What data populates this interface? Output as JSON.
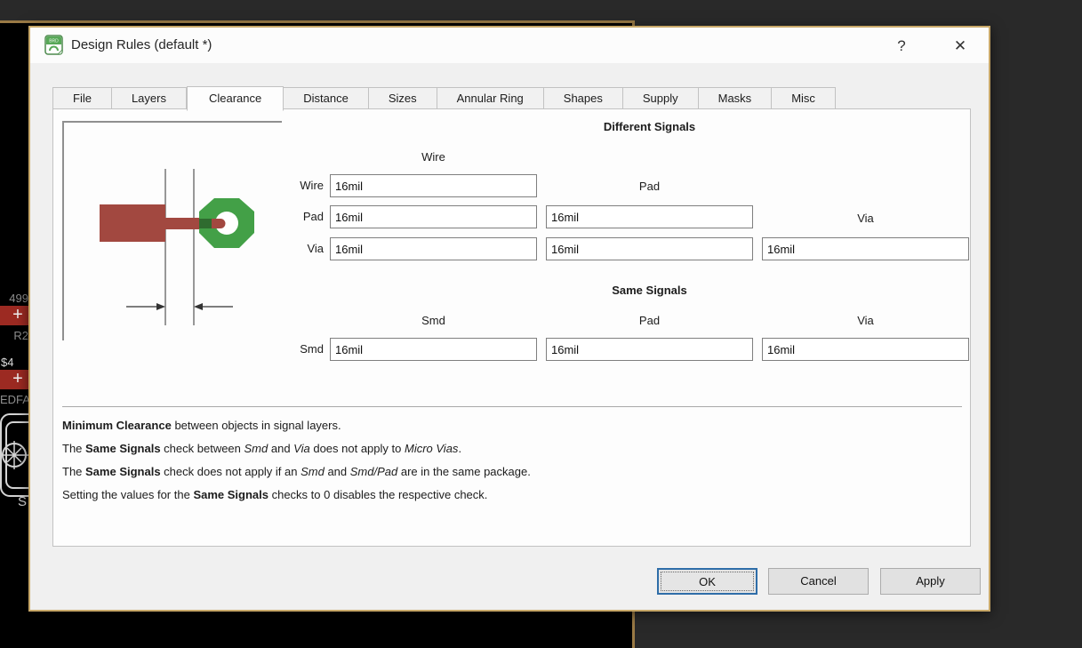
{
  "window": {
    "title": "Design Rules (default *)",
    "help_label": "?",
    "close_label": "✕"
  },
  "tabs": {
    "active_index": 2,
    "items": [
      "File",
      "Layers",
      "Clearance",
      "Distance",
      "Sizes",
      "Annular Ring",
      "Shapes",
      "Supply",
      "Masks",
      "Misc"
    ]
  },
  "clearance": {
    "different_signals": {
      "title": "Different Signals",
      "headers": {
        "wire": "Wire",
        "pad": "Pad",
        "via": "Via"
      },
      "rows": [
        {
          "label": "Wire",
          "values": [
            "16mil"
          ]
        },
        {
          "label": "Pad",
          "values": [
            "16mil",
            "16mil"
          ]
        },
        {
          "label": "Via",
          "values": [
            "16mil",
            "16mil",
            "16mil"
          ]
        }
      ]
    },
    "same_signals": {
      "title": "Same Signals",
      "headers": {
        "smd": "Smd",
        "pad": "Pad",
        "via": "Via"
      },
      "rows": [
        {
          "label": "Smd",
          "values": [
            "16mil",
            "16mil",
            "16mil"
          ]
        }
      ]
    },
    "notes": [
      [
        {
          "text": "Minimum Clearance",
          "b": true
        },
        {
          "text": " between objects in signal layers."
        }
      ],
      [
        {
          "text": "The "
        },
        {
          "text": "Same Signals",
          "b": true
        },
        {
          "text": " check between "
        },
        {
          "text": "Smd",
          "i": true
        },
        {
          "text": " and "
        },
        {
          "text": "Via",
          "i": true
        },
        {
          "text": " does not apply to "
        },
        {
          "text": "Micro Vias",
          "i": true
        },
        {
          "text": "."
        }
      ],
      [
        {
          "text": "The "
        },
        {
          "text": "Same Signals",
          "b": true
        },
        {
          "text": " check does not apply if an "
        },
        {
          "text": "Smd",
          "i": true
        },
        {
          "text": " and "
        },
        {
          "text": "Smd/Pad",
          "i": true
        },
        {
          "text": " are in the same package."
        }
      ],
      [
        {
          "text": "Setting the values for the "
        },
        {
          "text": "Same Signals",
          "b": true
        },
        {
          "text": " checks to 0 disables the respective check."
        }
      ]
    ]
  },
  "buttons": {
    "ok": "OK",
    "cancel": "Cancel",
    "apply": "Apply"
  },
  "pcb_background": {
    "labels": {
      "l499": "499",
      "r2": "R2",
      "d4": "$4",
      "edfa": "EDFA",
      "s": "S"
    },
    "pad_cross": "+"
  },
  "colors": {
    "dialog_border": "#c7a768",
    "board_outline": "#9a7a45",
    "copper_red": "#a24840",
    "pad_green": "#43a047",
    "ok_focus_border": "#2e6da8"
  }
}
